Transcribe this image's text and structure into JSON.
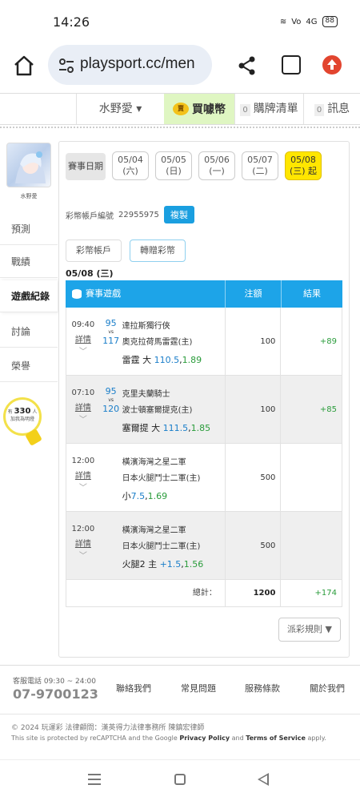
{
  "status": {
    "time": "14:26",
    "battery": "88",
    "signal": "4G"
  },
  "browser": {
    "url": "playsport.cc/men"
  },
  "sitenav": {
    "user": "水野愛 ▾",
    "coin_icon_text": "賣",
    "coins": "買噱幣",
    "cart_count": "0",
    "cart": "購牌清單",
    "msg_count": "0",
    "msg": "訊息"
  },
  "sidebar": {
    "avatar_name": "水野愛",
    "items": [
      "預測",
      "戰績",
      "遊戲紀錄",
      "討論",
      "榮譽"
    ],
    "bulb_prefix": "有",
    "bulb_count": "330",
    "bulb_unit": "人",
    "bulb_text": "加我為明燈"
  },
  "datebar": {
    "label": "賽事日期",
    "dates": [
      {
        "date": "05/04",
        "day": "(六)"
      },
      {
        "date": "05/05",
        "day": "(日)"
      },
      {
        "date": "05/06",
        "day": "(一)"
      },
      {
        "date": "05/07",
        "day": "(二)"
      },
      {
        "date": "05/08",
        "day": "(三) 起"
      }
    ]
  },
  "account": {
    "label": "彩幣帳戶編號",
    "number": "22955975",
    "copy": "複製"
  },
  "subtabs": [
    "彩幣帳戶",
    "轉贈彩幣"
  ],
  "current_date": "05/08 (三)",
  "table": {
    "headers": {
      "game": "賽事遊戲",
      "amount": "注額",
      "result": "結果"
    },
    "detail_label": "詳情",
    "vs": "vs",
    "rows": [
      {
        "time": "09:40",
        "id1": "95",
        "id2": "117",
        "team1": "達拉斯獨行俠",
        "team2": "奧克拉荷馬雷霆(主)",
        "bet_text": "雷霆 大",
        "bet_num": "110.5",
        "bet_odds": "1.89",
        "amount": "100",
        "result": "+89"
      },
      {
        "time": "07:10",
        "id1": "95",
        "id2": "120",
        "team1": "克里夫蘭騎士",
        "team2": "波士頓塞爾提克(主)",
        "bet_text": "塞爾提 大",
        "bet_num": "111.5",
        "bet_odds": "1.85",
        "amount": "100",
        "result": "+85"
      },
      {
        "time": "12:00",
        "id1": "",
        "id2": "",
        "team1": "橫濱海灣之星二軍",
        "team2": "日本火腿鬥士二軍(主)",
        "bet_text": "小",
        "bet_num": "7.5",
        "bet_odds": "1.69",
        "amount": "500",
        "result": ""
      },
      {
        "time": "12:00",
        "id1": "",
        "id2": "",
        "team1": "橫濱海灣之星二軍",
        "team2": "日本火腿鬥士二軍(主)",
        "bet_text": "火腿2 主",
        "bet_num": "+1.5",
        "bet_odds": "1.56",
        "amount": "500",
        "result": ""
      }
    ],
    "total_label": "總計：",
    "total_amount": "1200",
    "total_result": "+174"
  },
  "rules_button": "派彩規則 ▼",
  "footer": {
    "hotline_label": "客服電話 09:30 ~ 24:00",
    "hotline": "07-9700123",
    "links": [
      "聯絡我們",
      "常見問題",
      "服務條款",
      "關於我們"
    ],
    "copyright": "© 2024 玩運彩 法律顧問：漢英得力法律事務所 陳鎮宏律師",
    "recaptcha_pre": "This site is protected by reCAPTCHA and the Google ",
    "privacy": "Privacy Policy",
    "and": " and ",
    "terms": "Terms of Service",
    "apply": " apply."
  },
  "colors": {
    "accent_blue": "#1da4e8",
    "date_active": "#ffe600",
    "coin_bg": "#dff6c2",
    "win_green": "#2a9c3b"
  }
}
